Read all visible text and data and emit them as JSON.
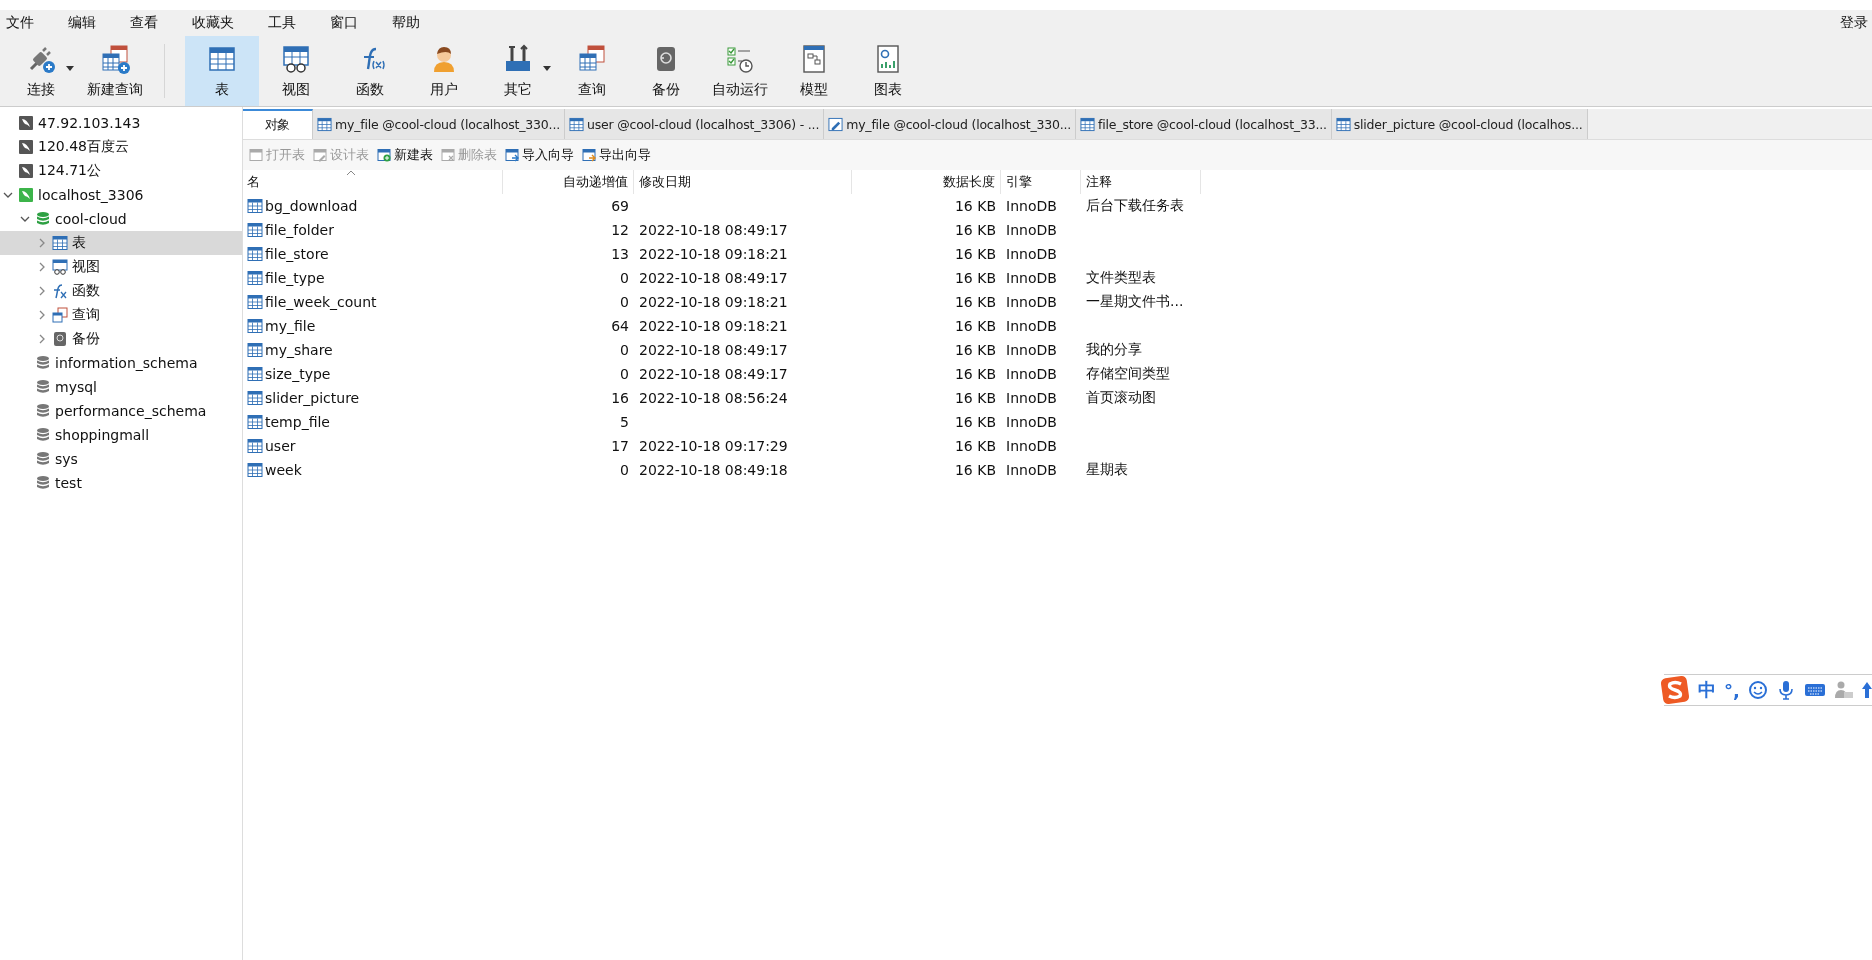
{
  "menu": [
    "文件",
    "编辑",
    "查看",
    "收藏夹",
    "工具",
    "窗口",
    "帮助"
  ],
  "login": "登录",
  "toolbar": [
    {
      "label": "连接",
      "kind": "connect",
      "selected": false,
      "dropdown": true
    },
    {
      "label": "新建查询",
      "kind": "new-query",
      "selected": false,
      "dropdown": false
    },
    {
      "label": "表",
      "kind": "table",
      "selected": true,
      "dropdown": false
    },
    {
      "label": "视图",
      "kind": "view",
      "selected": false,
      "dropdown": false
    },
    {
      "label": "函数",
      "kind": "function",
      "selected": false,
      "dropdown": false
    },
    {
      "label": "用户",
      "kind": "user",
      "selected": false,
      "dropdown": false
    },
    {
      "label": "其它",
      "kind": "tools",
      "selected": false,
      "dropdown": true
    },
    {
      "label": "查询",
      "kind": "query",
      "selected": false,
      "dropdown": false
    },
    {
      "label": "备份",
      "kind": "backup",
      "selected": false,
      "dropdown": false
    },
    {
      "label": "自动运行",
      "kind": "schedule",
      "selected": false,
      "dropdown": false
    },
    {
      "label": "模型",
      "kind": "model",
      "selected": false,
      "dropdown": false
    },
    {
      "label": "图表",
      "kind": "chart",
      "selected": false,
      "dropdown": false
    }
  ],
  "sidebar": [
    {
      "label": "47.92.103.143",
      "kind": "connection",
      "connected": false
    },
    {
      "label": "120.48百度云",
      "kind": "connection",
      "connected": false
    },
    {
      "label": "124.71公",
      "kind": "connection",
      "connected": false
    },
    {
      "label": "localhost_3306",
      "kind": "connection",
      "connected": true,
      "expanded": true,
      "children": [
        {
          "label": "cool-cloud",
          "kind": "database",
          "connected": true,
          "expanded": true,
          "children": [
            {
              "label": "表",
              "kind": "table",
              "selected": true,
              "expanded": false
            },
            {
              "label": "视图",
              "kind": "view",
              "selected": false,
              "expanded": false
            },
            {
              "label": "函数",
              "kind": "function",
              "selected": false,
              "expanded": false
            },
            {
              "label": "查询",
              "kind": "query",
              "selected": false,
              "expanded": false
            },
            {
              "label": "备份",
              "kind": "backup",
              "selected": false,
              "expanded": false
            }
          ]
        },
        {
          "label": "information_schema",
          "kind": "database",
          "connected": false
        },
        {
          "label": "mysql",
          "kind": "database",
          "connected": false
        },
        {
          "label": "performance_schema",
          "kind": "database",
          "connected": false
        },
        {
          "label": "shoppingmall",
          "kind": "database",
          "connected": false
        },
        {
          "label": "sys",
          "kind": "database",
          "connected": false
        },
        {
          "label": "test",
          "kind": "database",
          "connected": false
        }
      ]
    }
  ],
  "tabs": [
    {
      "label": "对象",
      "kind": "objects",
      "selected": true
    },
    {
      "label": "my_file @cool-cloud (localhost_330...",
      "kind": "table",
      "selected": false
    },
    {
      "label": "user @cool-cloud (localhost_3306) - ...",
      "kind": "table",
      "selected": false
    },
    {
      "label": "my_file @cool-cloud (localhost_330...",
      "kind": "design",
      "selected": false
    },
    {
      "label": "file_store @cool-cloud (localhost_33...",
      "kind": "table",
      "selected": false
    },
    {
      "label": "slider_picture @cool-cloud (localhos...",
      "kind": "table",
      "selected": false
    }
  ],
  "actions": [
    {
      "label": "打开表",
      "kind": "open",
      "disabled": true
    },
    {
      "label": "设计表",
      "kind": "design",
      "disabled": true
    },
    {
      "label": "新建表",
      "kind": "new",
      "disabled": false
    },
    {
      "label": "删除表",
      "kind": "delete",
      "disabled": true
    },
    {
      "label": "导入向导",
      "kind": "import",
      "disabled": false
    },
    {
      "label": "导出向导",
      "kind": "export",
      "disabled": false
    }
  ],
  "table": {
    "columns": [
      {
        "label": "名",
        "sorted": true
      },
      {
        "label": "自动递增值",
        "sorted": false
      },
      {
        "label": "修改日期",
        "sorted": false
      },
      {
        "label": "数据长度",
        "sorted": false
      },
      {
        "label": "引擎",
        "sorted": false
      },
      {
        "label": "注释",
        "sorted": false
      }
    ],
    "rows": [
      {
        "name": "bg_download",
        "auto_increment": "69",
        "modified": "",
        "data_length": "16 KB",
        "engine": "InnoDB",
        "comment": "后台下载任务表"
      },
      {
        "name": "file_folder",
        "auto_increment": "12",
        "modified": "2022-10-18 08:49:17",
        "data_length": "16 KB",
        "engine": "InnoDB",
        "comment": ""
      },
      {
        "name": "file_store",
        "auto_increment": "13",
        "modified": "2022-10-18 09:18:21",
        "data_length": "16 KB",
        "engine": "InnoDB",
        "comment": ""
      },
      {
        "name": "file_type",
        "auto_increment": "0",
        "modified": "2022-10-18 08:49:17",
        "data_length": "16 KB",
        "engine": "InnoDB",
        "comment": "文件类型表"
      },
      {
        "name": "file_week_count",
        "auto_increment": "0",
        "modified": "2022-10-18 09:18:21",
        "data_length": "16 KB",
        "engine": "InnoDB",
        "comment": "一星期文件书..."
      },
      {
        "name": "my_file",
        "auto_increment": "64",
        "modified": "2022-10-18 09:18:21",
        "data_length": "16 KB",
        "engine": "InnoDB",
        "comment": ""
      },
      {
        "name": "my_share",
        "auto_increment": "0",
        "modified": "2022-10-18 08:49:17",
        "data_length": "16 KB",
        "engine": "InnoDB",
        "comment": "我的分享"
      },
      {
        "name": "size_type",
        "auto_increment": "0",
        "modified": "2022-10-18 08:49:17",
        "data_length": "16 KB",
        "engine": "InnoDB",
        "comment": "存储空间类型"
      },
      {
        "name": "slider_picture",
        "auto_increment": "16",
        "modified": "2022-10-18 08:56:24",
        "data_length": "16 KB",
        "engine": "InnoDB",
        "comment": "首页滚动图"
      },
      {
        "name": "temp_file",
        "auto_increment": "5",
        "modified": "",
        "data_length": "16 KB",
        "engine": "InnoDB",
        "comment": ""
      },
      {
        "name": "user",
        "auto_increment": "17",
        "modified": "2022-10-18 09:17:29",
        "data_length": "16 KB",
        "engine": "InnoDB",
        "comment": ""
      },
      {
        "name": "week",
        "auto_increment": "0",
        "modified": "2022-10-18 08:49:18",
        "data_length": "16 KB",
        "engine": "InnoDB",
        "comment": "星期表"
      }
    ]
  },
  "ime": {
    "mode": "中",
    "punctuation": "°,"
  }
}
